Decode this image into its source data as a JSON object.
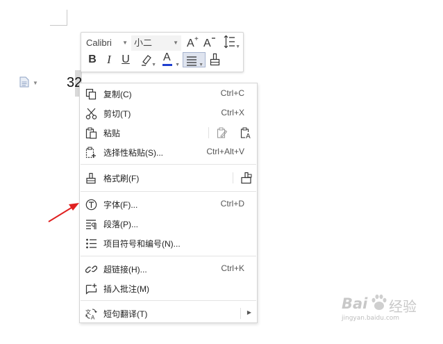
{
  "document": {
    "text": "32"
  },
  "toolbar": {
    "font_name": "Calibri",
    "font_size": "小二",
    "grow_font_icon": "A+",
    "shrink_font_icon": "A-",
    "bold": "B",
    "italic": "I",
    "underline": "U",
    "font_color": "A"
  },
  "menu": {
    "items": [
      {
        "label": "复制(C)",
        "shortcut": "Ctrl+C",
        "icon": "copy-icon"
      },
      {
        "label": "剪切(T)",
        "shortcut": "Ctrl+X",
        "icon": "scissors-icon"
      },
      {
        "label": "粘贴",
        "shortcut": "",
        "icon": "paste-icon"
      },
      {
        "label": "选择性粘贴(S)...",
        "shortcut": "Ctrl+Alt+V",
        "icon": "paste-special-icon"
      },
      {
        "label": "格式刷(F)",
        "shortcut": "",
        "icon": "format-painter-icon"
      },
      {
        "label": "字体(F)...",
        "shortcut": "Ctrl+D",
        "icon": "font-icon"
      },
      {
        "label": "段落(P)...",
        "shortcut": "",
        "icon": "paragraph-icon"
      },
      {
        "label": "项目符号和编号(N)...",
        "shortcut": "",
        "icon": "bullet-list-icon"
      },
      {
        "label": "超链接(H)...",
        "shortcut": "Ctrl+K",
        "icon": "link-icon"
      },
      {
        "label": "插入批注(M)",
        "shortcut": "",
        "icon": "comment-icon"
      },
      {
        "label": "短句翻译(T)",
        "shortcut": "",
        "icon": "translate-icon"
      }
    ]
  },
  "watermark": {
    "brand": "Bai",
    "brand2": "经验",
    "url": "jingyan.baidu.com"
  },
  "colors": {
    "arrow": "#e02020",
    "font_color_bar": "#1f3fd0",
    "active_bg": "#dfe4ef"
  }
}
